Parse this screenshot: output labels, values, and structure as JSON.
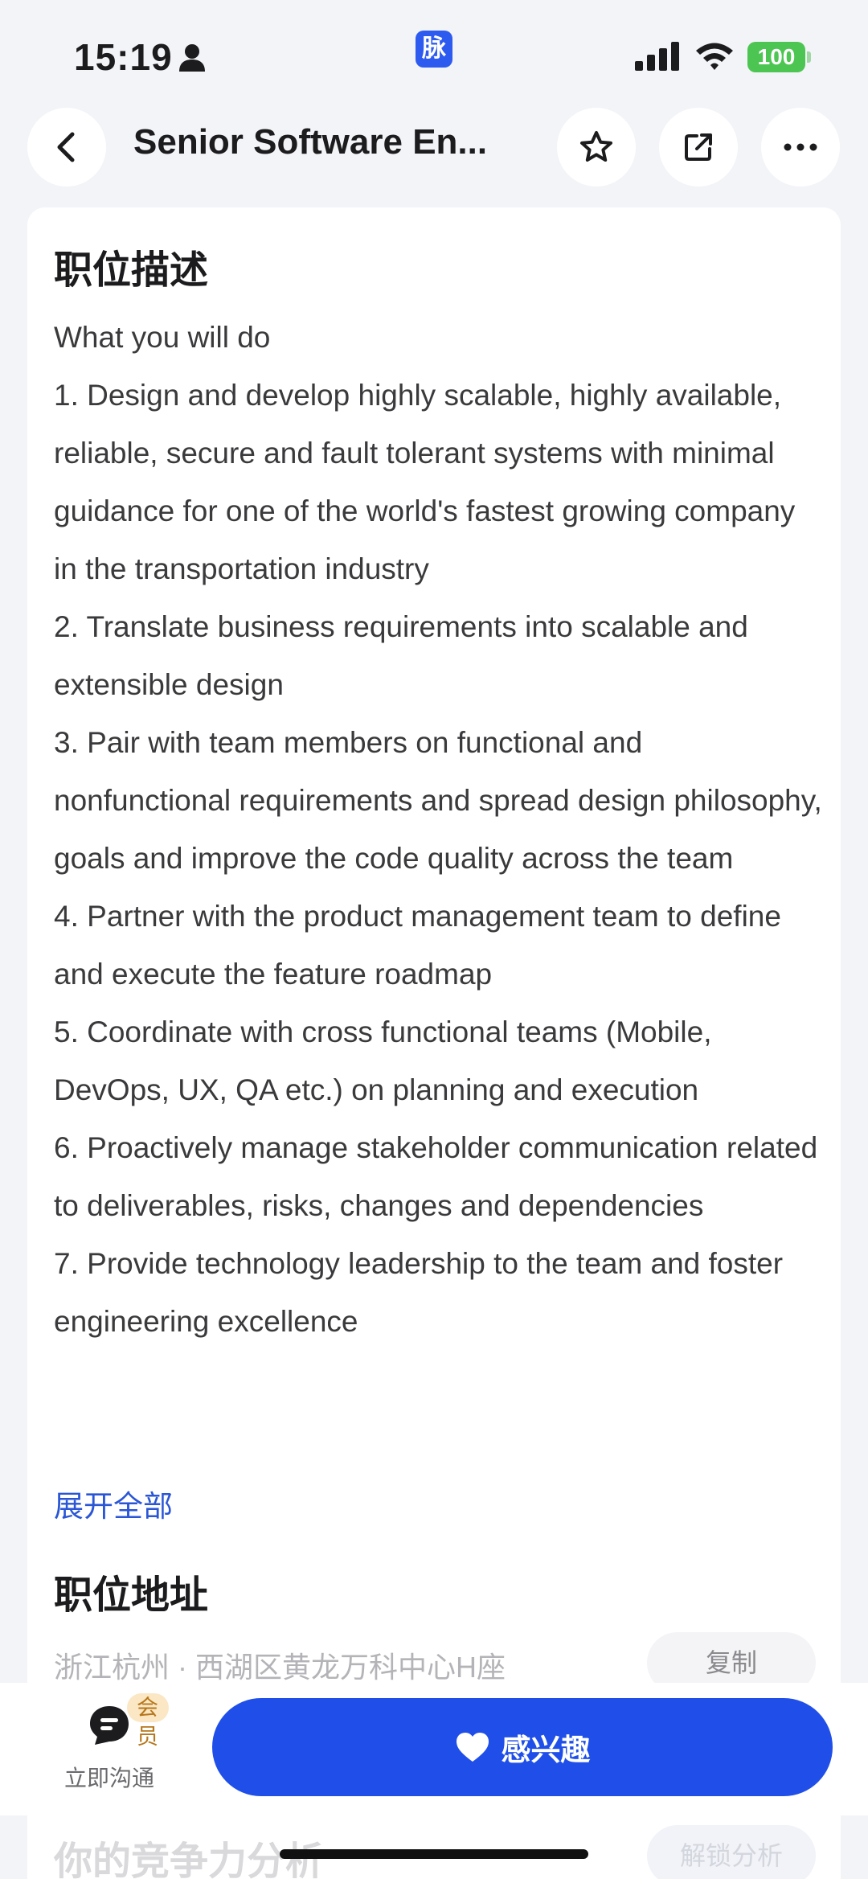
{
  "status_bar": {
    "time": "15:19",
    "app_badge": "脉",
    "battery": "100",
    "icons": [
      "person-icon",
      "signal-icon",
      "wifi-icon",
      "battery-icon"
    ]
  },
  "nav": {
    "title": "Senior Software En...",
    "icons": [
      "chevron-left-icon",
      "star-icon",
      "share-icon",
      "more-icon"
    ]
  },
  "description": {
    "title": "职位描述",
    "lines": [
      "What you will do",
      "1. Design and develop highly scalable, highly available, reliable, secure and fault tolerant systems with minimal guidance for one of the world's fastest growing company in the transportation industry",
      "2. Translate business requirements into scalable and extensible design",
      "3. Pair with team members on functional and nonfunctional requirements and spread design philosophy, goals and improve the code quality across the team",
      "4. Partner with the product management team to define and execute the feature roadmap",
      "5. Coordinate with cross functional teams (Mobile, DevOps, UX, QA etc.) on planning and execution",
      "6. Proactively manage stakeholder communication related to deliverables, risks, changes and dependencies",
      "7. Provide technology leadership to the team and foster engineering excellence"
    ],
    "expand": "展开全部"
  },
  "address": {
    "title": "职位地址",
    "text": "浙江杭州 · 西湖区黄龙万科中心H座",
    "copy": "复制"
  },
  "competitiveness": {
    "title": "你的竞争力分析",
    "button": "解锁分析"
  },
  "bottom": {
    "chat_label": "立即沟通",
    "member_badge": "会员",
    "interest": "感兴趣"
  },
  "colors": {
    "accent": "#1f4fe8",
    "link": "#2a56d6",
    "battery": "#4cc552",
    "badge_bg": "#fbe7c4"
  }
}
